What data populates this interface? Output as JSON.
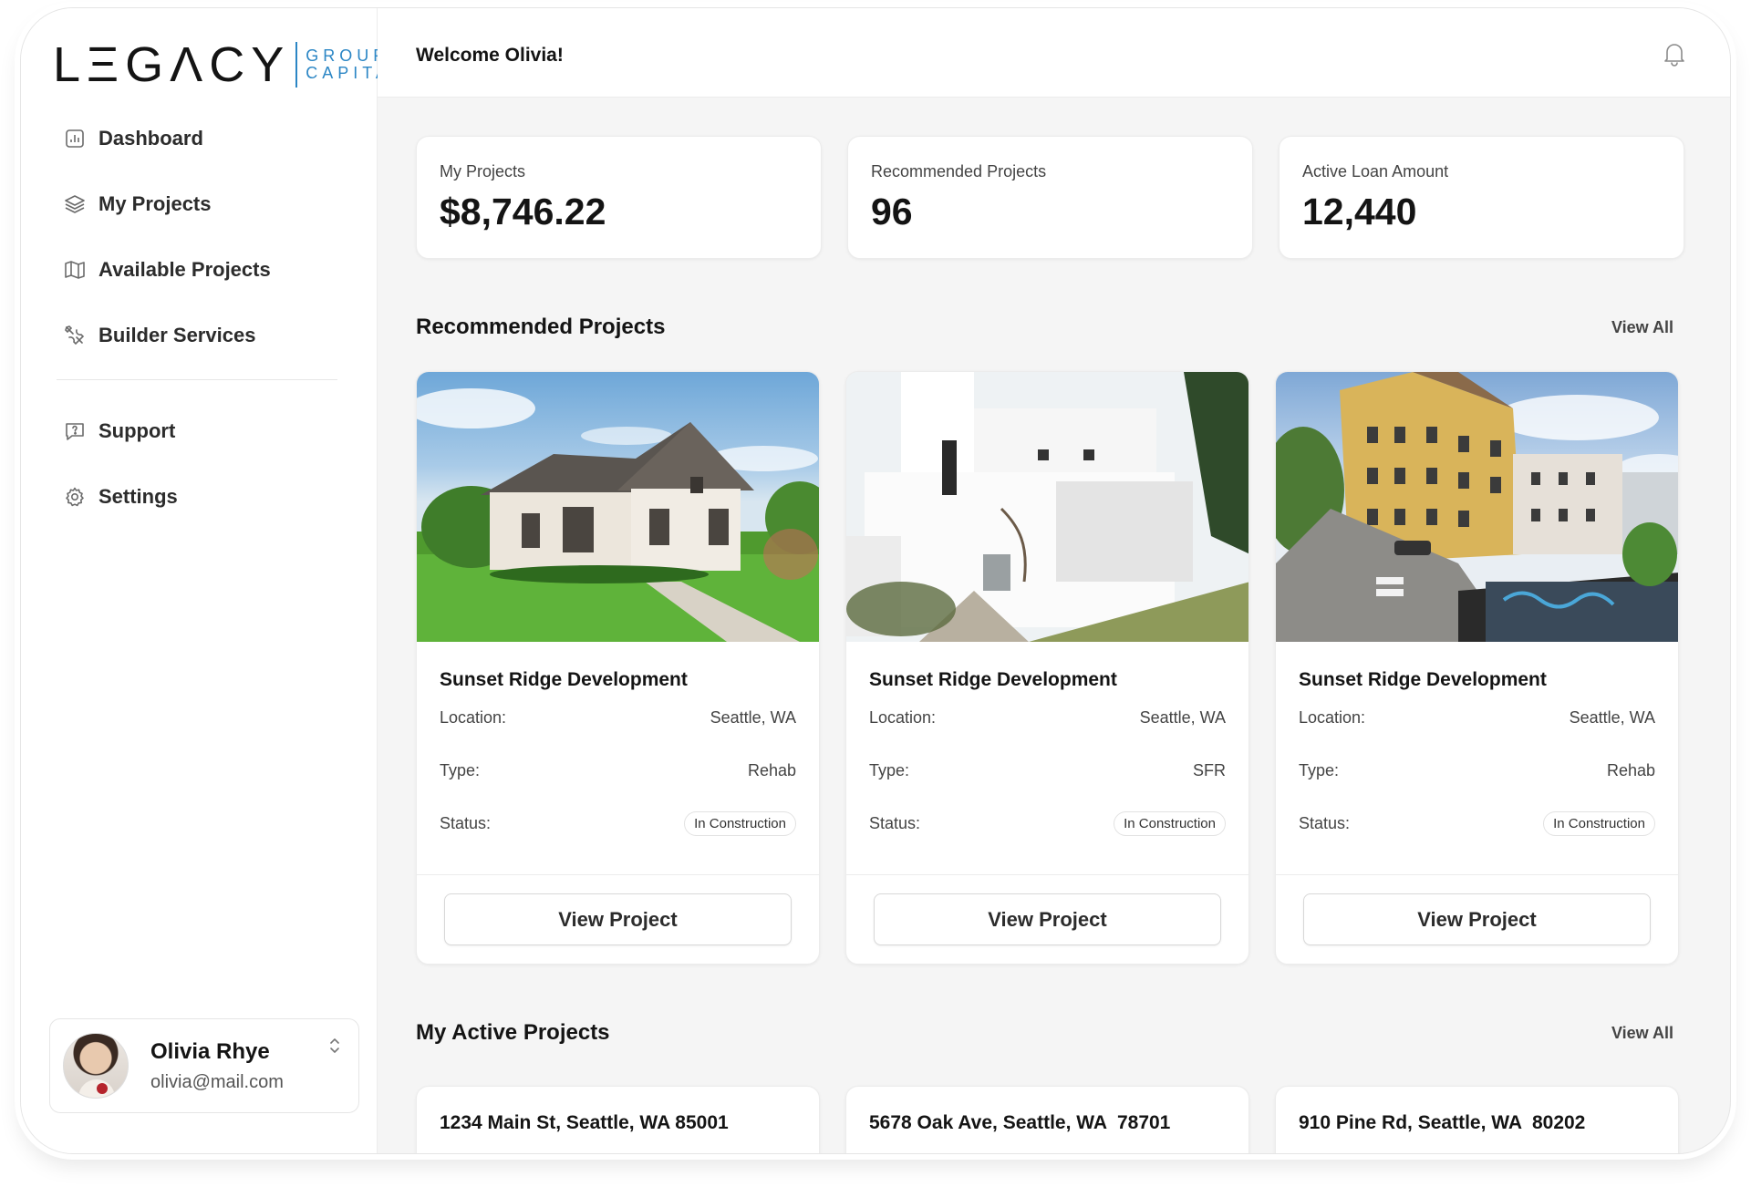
{
  "brand": {
    "logo_main": "LΞGΛCY",
    "logo_sub_1": "GROUP",
    "logo_sub_2": "CAPITAL",
    "accent_color": "#2b86c5"
  },
  "sidebar": {
    "items": [
      {
        "label": "Dashboard",
        "icon": "bar-chart-icon"
      },
      {
        "label": "My Projects",
        "icon": "layers-icon"
      },
      {
        "label": "Available Projects",
        "icon": "map-icon"
      },
      {
        "label": "Builder Services",
        "icon": "tools-icon"
      }
    ],
    "secondary_items": [
      {
        "label": "Support",
        "icon": "help-chat-icon"
      },
      {
        "label": "Settings",
        "icon": "gear-icon"
      }
    ]
  },
  "user": {
    "name": "Olivia Rhye",
    "email": "olivia@mail.com"
  },
  "topbar": {
    "welcome": "Welcome Olivia!",
    "bell_icon": "bell-icon"
  },
  "stats": [
    {
      "label": "My Projects",
      "value": "$8,746.22"
    },
    {
      "label": "Recommended Projects",
      "value": "96"
    },
    {
      "label": "Active Loan Amount",
      "value": "12,440"
    }
  ],
  "recommended": {
    "title": "Recommended Projects",
    "view_all": "View All",
    "projects": [
      {
        "title": "Sunset Ridge Development",
        "location_label": "Location:",
        "location": "Seattle, WA",
        "type_label": "Type:",
        "type": "Rehab",
        "status_label": "Status:",
        "status": "In Construction",
        "button": "View Project"
      },
      {
        "title": "Sunset Ridge Development",
        "location_label": "Location:",
        "location": "Seattle, WA",
        "type_label": "Type:",
        "type": "SFR",
        "status_label": "Status:",
        "status": "In Construction",
        "button": "View Project"
      },
      {
        "title": "Sunset Ridge Development",
        "location_label": "Location:",
        "location": "Seattle, WA",
        "type_label": "Type:",
        "type": "Rehab",
        "status_label": "Status:",
        "status": "In Construction",
        "button": "View Project"
      }
    ]
  },
  "active": {
    "title": "My Active Projects",
    "view_all": "View All",
    "projects": [
      {
        "address": "1234 Main St, Seattle, WA 85001"
      },
      {
        "address": "5678 Oak Ave, Seattle, WA  78701"
      },
      {
        "address": "910 Pine Rd, Seattle, WA  80202"
      }
    ]
  }
}
